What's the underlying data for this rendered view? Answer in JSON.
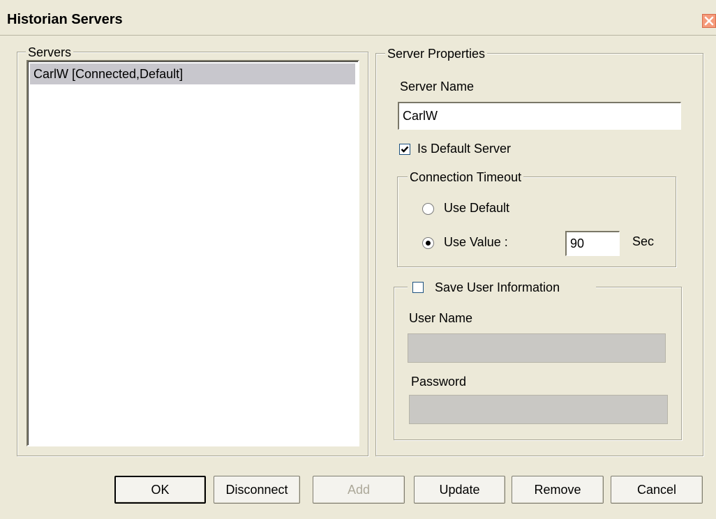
{
  "window": {
    "title": "Historian Servers"
  },
  "servers_group": {
    "legend": "Servers",
    "items": [
      {
        "label": "CarlW [Connected,Default]",
        "selected": true
      }
    ]
  },
  "properties_group": {
    "legend": "Server Properties",
    "server_name_label": "Server Name",
    "server_name_value": "CarlW",
    "is_default_label": "Is Default Server",
    "is_default_checked": true,
    "timeout_group": {
      "legend": "Connection Timeout",
      "use_default_label": "Use Default",
      "use_value_label": "Use Value :",
      "selected": "use_value",
      "value": "90",
      "unit": "Sec"
    },
    "user_group": {
      "save_label": "Save User Information",
      "save_checked": false,
      "user_name_label": "User Name",
      "user_name_value": "",
      "password_label": "Password",
      "password_value": ""
    }
  },
  "buttons": {
    "ok": "OK",
    "disconnect": "Disconnect",
    "add": "Add",
    "update": "Update",
    "remove": "Remove",
    "cancel": "Cancel"
  },
  "colors": {
    "dialog_bg": "#ece9d8",
    "selection_bg": "#c8c7cd",
    "close_button": "#f59a7a"
  }
}
